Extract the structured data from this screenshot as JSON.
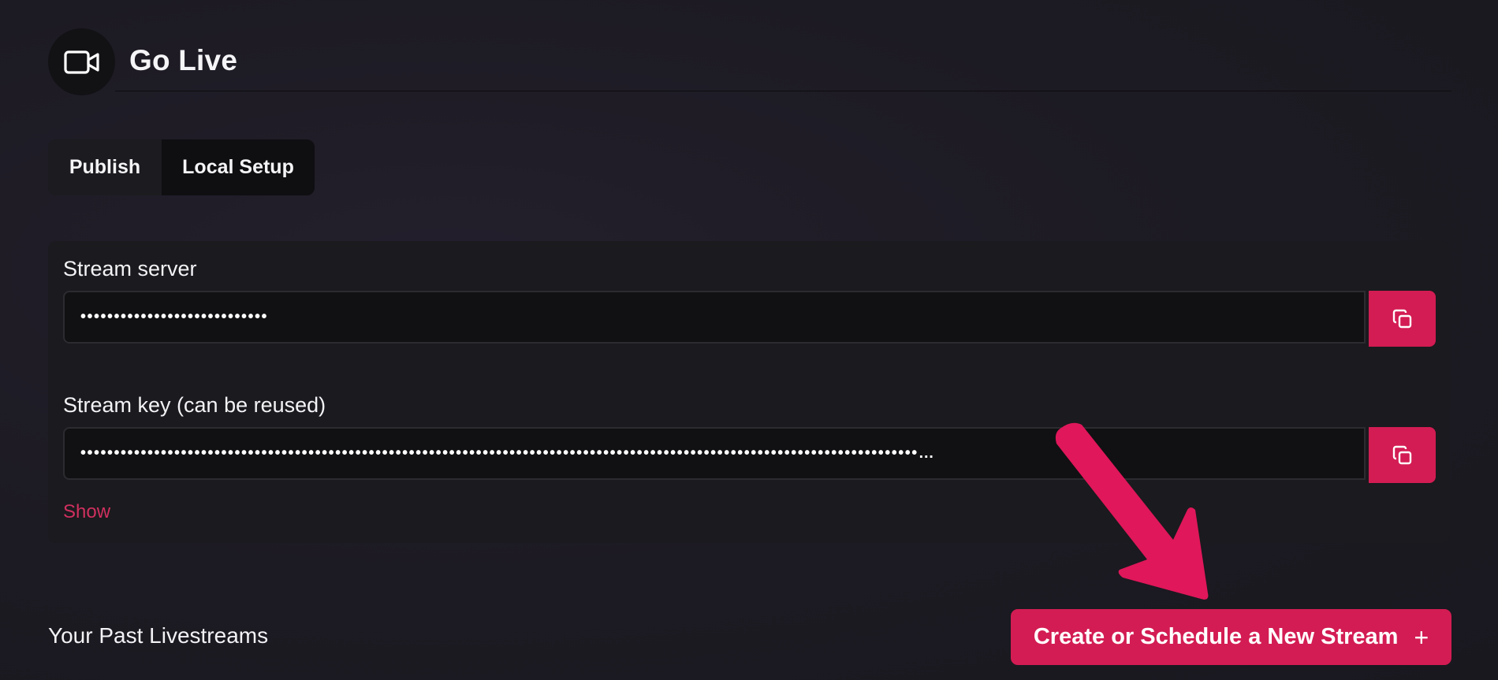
{
  "header": {
    "title": "Go Live",
    "icon": "video-camera-icon"
  },
  "tabs": [
    {
      "label": "Publish",
      "active": false
    },
    {
      "label": "Local Setup",
      "active": true
    }
  ],
  "stream_server": {
    "label": "Stream server",
    "masked_value": "••••••••••••••••••••••••••••",
    "copy_icon": "copy-icon"
  },
  "stream_key": {
    "label": "Stream key (can be reused)",
    "masked_value": "•••••••••••••••••••••••••••••••••••••••••••••••••••••••••••••••••••••••••••••••••••••••••••••••••••••••••••••••••••••••••••••…",
    "copy_icon": "copy-icon",
    "show_label": "Show"
  },
  "past_livestreams": {
    "title": "Your Past Livestreams"
  },
  "create_button": {
    "label": "Create or Schedule a New Stream",
    "icon": "plus-icon",
    "plus_glyph": "+"
  },
  "colors": {
    "accent": "#d31c53",
    "background": "#1c1a22",
    "card": "#1b1a1e",
    "input": "#111012"
  }
}
